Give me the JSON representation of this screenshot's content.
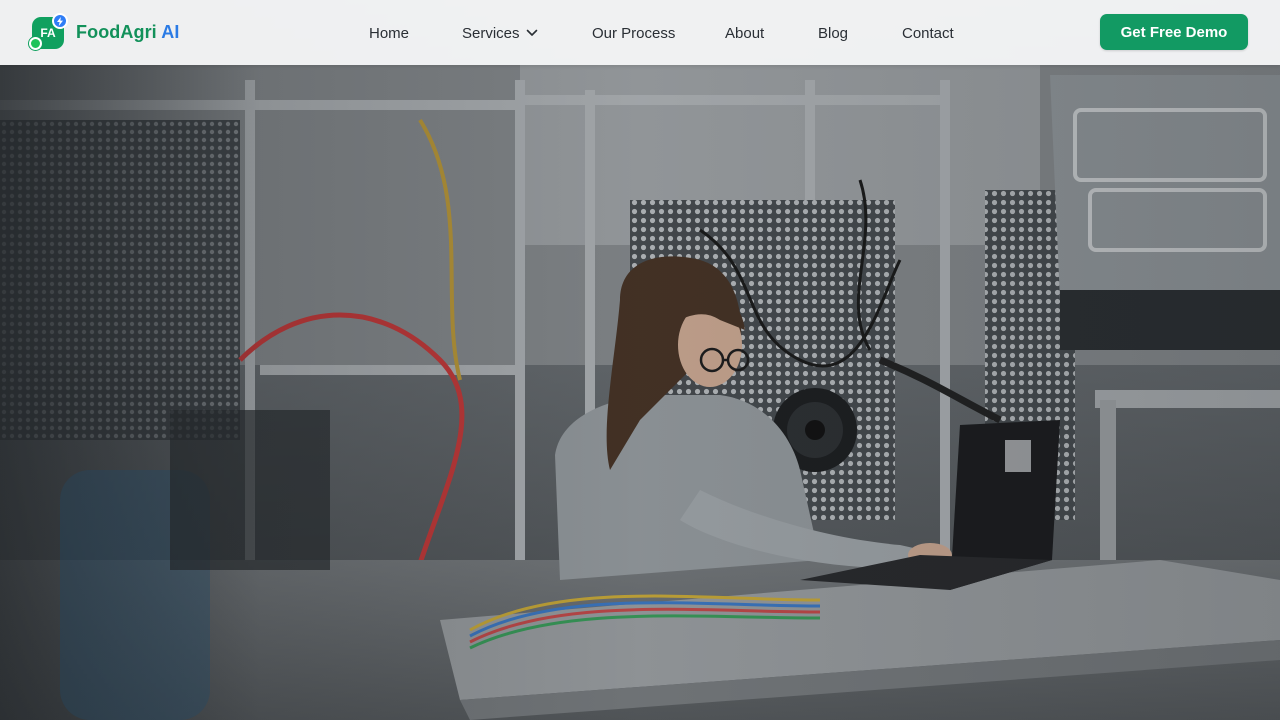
{
  "brand": {
    "logo_initials": "FA",
    "name_part1": "FoodAgri",
    "name_part2": "AI",
    "colors": {
      "green": "#12915a",
      "blue": "#2b7be5"
    }
  },
  "nav": {
    "items": [
      {
        "label": "Home"
      },
      {
        "label": "Services",
        "has_dropdown": true,
        "icon": "chevron-down-icon"
      },
      {
        "label": "Our Process"
      },
      {
        "label": "About"
      },
      {
        "label": "Blog"
      },
      {
        "label": "Contact"
      }
    ]
  },
  "cta": {
    "label": "Get Free Demo",
    "color": "#129a63"
  },
  "hero": {
    "image_subject": "hero-photo"
  }
}
